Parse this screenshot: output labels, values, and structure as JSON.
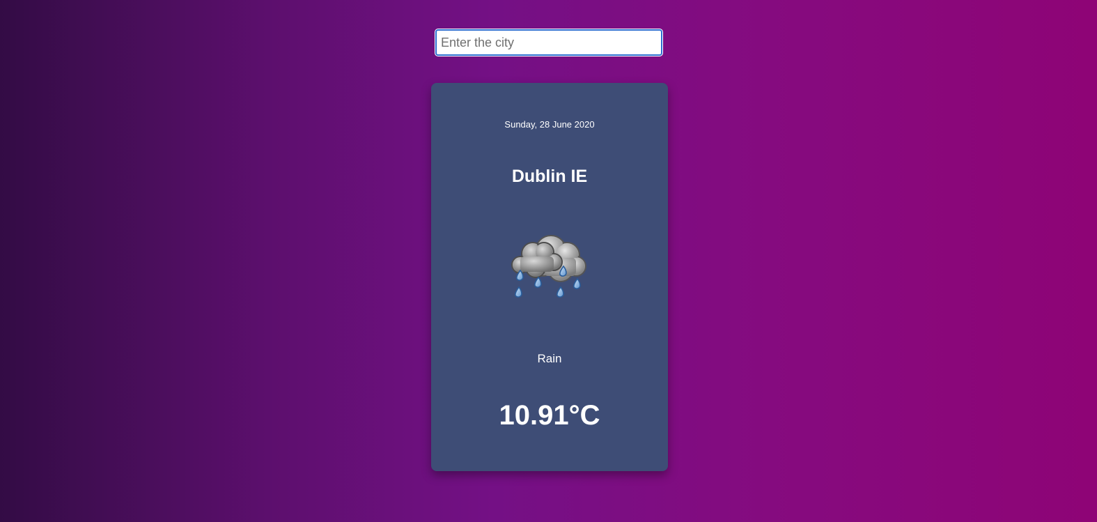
{
  "search": {
    "placeholder": "Enter the city",
    "value": ""
  },
  "weather": {
    "date": "Sunday, 28 June 2020",
    "location": "Dublin IE",
    "icon": "rain-cloud-icon",
    "condition": "Rain",
    "temperature": "10.91°C"
  },
  "colors": {
    "background_gradient": [
      "#330c45",
      "#741085",
      "#8e0476"
    ],
    "card": "#3e4d76",
    "input_border": "#2d6fd0"
  }
}
